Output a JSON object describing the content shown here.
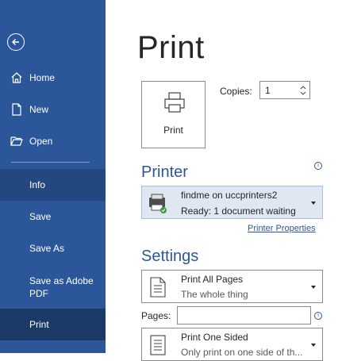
{
  "sidebar": {
    "items": [
      {
        "label": "Home",
        "icon": "home-icon"
      },
      {
        "label": "New",
        "icon": "new-document-icon"
      },
      {
        "label": "Open",
        "icon": "folder-open-icon"
      },
      {
        "label": "Info"
      },
      {
        "label": "Save"
      },
      {
        "label": "Save As"
      },
      {
        "label": "Save as Adobe PDF"
      },
      {
        "label": "Print"
      }
    ],
    "selected": "Print",
    "background_color": "#2b579a"
  },
  "main": {
    "title": "Print",
    "print_button_label": "Print",
    "copies_label": "Copies:",
    "copies_value": "1",
    "printer_section_title": "Printer",
    "printer": {
      "name": "findme on uccprinters2",
      "status": "Ready: 1 document waiting"
    },
    "printer_properties_link": "Printer Properties",
    "settings_section_title": "Settings",
    "settings": {
      "pages_option": {
        "primary": "Print All Pages",
        "secondary": "The whole thing"
      },
      "pages_label": "Pages:",
      "pages_value": "",
      "sides_option": {
        "primary": "Print One Sided",
        "secondary": "Only print on one side of th..."
      }
    },
    "accent_color": "#2b579a"
  }
}
